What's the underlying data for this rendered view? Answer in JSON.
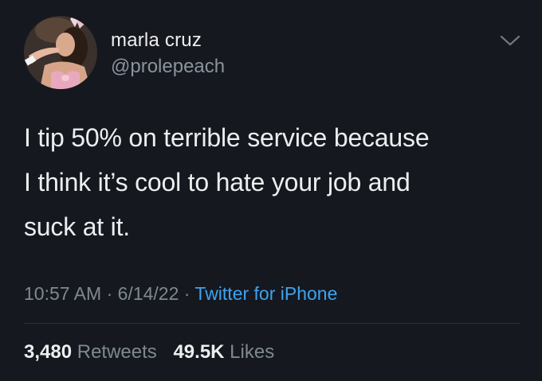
{
  "user": {
    "display_name": "marla cruz",
    "handle": "@prolepeach"
  },
  "tweet": {
    "lines": [
      "I tip 50% on terrible service because",
      "I think it’s cool to hate your job and",
      "suck at it."
    ]
  },
  "meta": {
    "time": "10:57 AM",
    "separator": " · ",
    "date": "6/14/22",
    "source": "Twitter for iPhone"
  },
  "stats": {
    "retweets_count": "3,480",
    "retweets_label": "Retweets",
    "likes_count": "49.5K",
    "likes_label": "Likes"
  },
  "colors": {
    "background": "#15181f",
    "link": "#3ea3f0",
    "muted": "#7f8890"
  },
  "icons": {
    "menu": "chevron-down-icon"
  }
}
